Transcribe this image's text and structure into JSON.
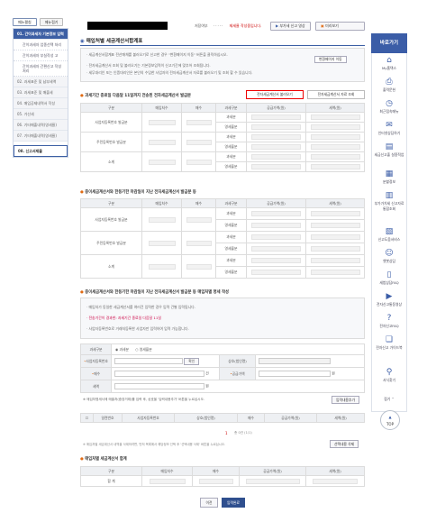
{
  "left_nav": {
    "top_buttons": [
      "메뉴펼침",
      "메뉴접기"
    ],
    "items": [
      {
        "label": "01. 간이과세자 기본정보 입력",
        "state": "active"
      },
      {
        "label": "간이과세자 업종선택 처리",
        "state": "sub"
      },
      {
        "label": "간이과세자 부실작성 고",
        "state": "sub"
      },
      {
        "label": "간이과세자 간편신고 작성 처리",
        "state": "sub"
      },
      {
        "label": "02. 과세표준 및 납부세액",
        "state": "normal"
      },
      {
        "label": "03. 과세표준 및 매출세",
        "state": "normal"
      },
      {
        "label": "04. 매입공제내역서 작성",
        "state": "normal"
      },
      {
        "label": "05. 가산세",
        "state": "normal"
      },
      {
        "label": "06. 기타매출내역(영세율)",
        "state": "normal"
      },
      {
        "label": "07. 기타매출내역(영세율)",
        "state": "normal"
      },
      {
        "label": "08. 신고서제출",
        "state": "last"
      }
    ]
  },
  "header": {
    "step_prefix": "저장여부",
    "step_dots": "·····",
    "step_status": "제세율 작성중입니다.",
    "buttons": [
      "부가세 신고 영상",
      "미리보기"
    ]
  },
  "page_title": "매입처별 세금계산서합계표",
  "info_lines": [
    "· 세금계산서합계표 전산매체를 불러오기로 신고한 경우 \"변환페이지 이동\" 버튼을 클릭하십시오.",
    "· 전자세금계산서 조회 및 불러오기는 기본정보입력이 신고기간에 맞추어 조회됩니다.",
    "· 세무대리인 또는 인증대리인은 본인의 수임한 사업자의 전자세금계산서 자료를 불러오기 및 조회 할 수 있습니다."
  ],
  "convert_button": "변환페이지 이동",
  "section1": {
    "title": "과세기간 종료일 다음달 11일까지 전송된 전자세금계산서 발급분",
    "fetch_button": "전자세금계산서 불러오기",
    "inquiry_button": "전자세금계산서 자료 조회",
    "headers": [
      "구분",
      "매입처수",
      "매수",
      "과세구분",
      "공급가액(원)",
      "세액(원)"
    ],
    "rows": [
      "사업자등록번호 발급분",
      "주민등록번호 발급분",
      "소계"
    ],
    "subtypes": [
      "과세분",
      "영세율분"
    ]
  },
  "section2": {
    "title": "종이세금계산서와 한등기한 마감일이 지난 전자세금계산서 발급분 등",
    "headers": [
      "구분",
      "매입처수",
      "매수",
      "과세구분",
      "공급가액(원)",
      "세액(원)"
    ],
    "rows": [
      "사업자등록번호 발급분",
      "주민등록번호 발급분",
      "소계"
    ],
    "subtypes": [
      "과세분",
      "영세율분"
    ]
  },
  "section3": {
    "title": "종이세금계산서와 한등기한 마감일이 지난 전자세금계산서 발급분 등 매입처별 명세 작성",
    "notes": [
      "· 매입처가 동일한 세금계산서를 여러건 입력한 경우 입력 건별 입력됩니다.",
      "· 전송기간이 경과한: 과세기간 종료일 다음달 11일",
      "· 사업자등록번호로 거래처등록한 사업자만 입력하여 입력 가능합니다."
    ],
    "form": {
      "tax_type_label": "과세구분",
      "tax_type_options": [
        "과세분",
        "영세율분"
      ],
      "biz_no_label": "사업자등록번호",
      "confirm_button": "확인",
      "company_label": "상호(법인명)",
      "count_label": "매수",
      "count_unit": "건",
      "amount_label": "공급가액",
      "amount_unit": "원",
      "tax_label": "세액",
      "tax_unit": "원"
    },
    "hint": "※ 매입처명세서에 매출처(중장거래)를 입력 후, 상호을 '입력내용추가' 버튼을 누르십시오.",
    "add_button": "입력내용추가",
    "list_headers": [
      "",
      "일련번호",
      "사업자등록번호",
      "상호(법인명)",
      "매수",
      "공급가액(원)",
      "세액(원)"
    ],
    "pager": "1",
    "pager_suffix": "총 0건 (1/1)",
    "delete_hint": "※ 매입처별 세금계산서 내역을 삭제하려면, 먼저 목록에서 해당정보 선택 후 '선택내용 삭제' 버튼을 누르십시오.",
    "delete_button": "선택내용 삭제"
  },
  "section4": {
    "title": "매입처별 세금계산서 합계",
    "headers": [
      "구분",
      "매입처수",
      "매수",
      "공급가액(원)",
      "세액(원)"
    ],
    "row_label": "합 계"
  },
  "bottom_buttons": [
    "이전",
    "입력완료"
  ],
  "right_sidebar": {
    "title": "바로가기",
    "items": [
      {
        "label": "My홈택스",
        "icon": "house-icon"
      },
      {
        "label": "출력문헌",
        "icon": "printer-icon"
      },
      {
        "label": "최근접속메뉴",
        "icon": "clock-icon"
      },
      {
        "label": "인터넷상담하기",
        "icon": "chat-icon"
      },
      {
        "label": "세금신고출 실용적업",
        "icon": "document-icon"
      },
      {
        "label": "분할정보",
        "icon": "calculator-icon"
      },
      {
        "label": "부가가치세 신고자료 통합조회",
        "icon": "search-doc-icon"
      },
      {
        "label": "신고도움서비스",
        "icon": "help-doc-icon"
      },
      {
        "label": "챗봇상담",
        "icon": "robot-icon"
      },
      {
        "label": "세법상담FAQ",
        "icon": "book-icon"
      },
      {
        "label": "전자신고통동영상",
        "icon": "video-icon"
      },
      {
        "label": "전자신고FAQ",
        "icon": "faq-icon"
      },
      {
        "label": "전자신고 가이드북",
        "icon": "guide-icon"
      },
      {
        "label": "서식찾기",
        "icon": "magnifier-icon"
      },
      {
        "label": "접기",
        "icon": "chevron-up-icon"
      }
    ],
    "top_button": "TOP"
  },
  "colors": {
    "primary": "#3b5da7",
    "accent": "#e06b14",
    "highlight": "#e00000"
  }
}
